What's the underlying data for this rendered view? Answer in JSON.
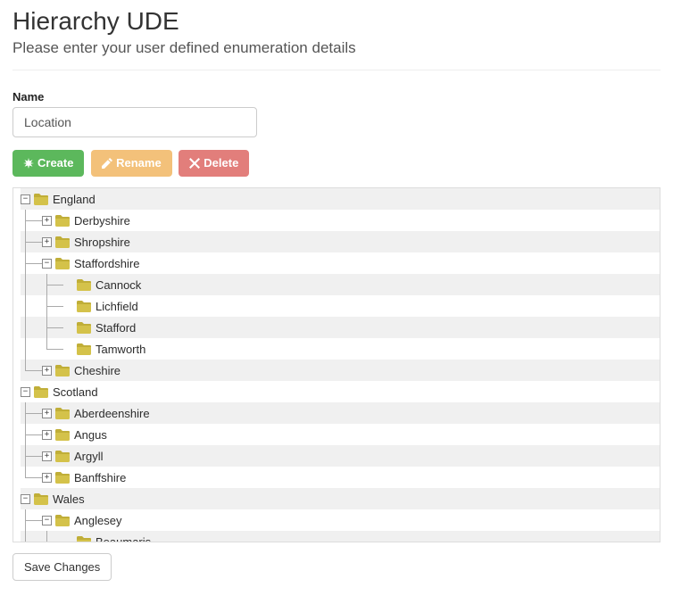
{
  "page": {
    "title": "Hierarchy UDE",
    "subtitle": "Please enter your user defined enumeration details"
  },
  "form": {
    "name_label": "Name",
    "name_value": "Location"
  },
  "buttons": {
    "create": "Create",
    "rename": "Rename",
    "delete": "Delete",
    "save": "Save Changes"
  },
  "tree_rows": [
    {
      "depth": 0,
      "toggle": "minus",
      "label": "England",
      "alt": true
    },
    {
      "depth": 1,
      "toggle": "plus",
      "label": "Derbyshire",
      "alt": false,
      "ancestors": [
        "full"
      ],
      "elbow": "tee"
    },
    {
      "depth": 1,
      "toggle": "plus",
      "label": "Shropshire",
      "alt": true,
      "ancestors": [
        "full"
      ],
      "elbow": "tee"
    },
    {
      "depth": 1,
      "toggle": "minus",
      "label": "Staffordshire",
      "alt": false,
      "ancestors": [
        "full"
      ],
      "elbow": "tee"
    },
    {
      "depth": 2,
      "toggle": "none",
      "label": "Cannock",
      "alt": true,
      "ancestors": [
        "full",
        "full"
      ],
      "elbow": "tee"
    },
    {
      "depth": 2,
      "toggle": "none",
      "label": "Lichfield",
      "alt": false,
      "ancestors": [
        "full",
        "full"
      ],
      "elbow": "tee"
    },
    {
      "depth": 2,
      "toggle": "none",
      "label": "Stafford",
      "alt": true,
      "ancestors": [
        "full",
        "full"
      ],
      "elbow": "tee"
    },
    {
      "depth": 2,
      "toggle": "none",
      "label": "Tamworth",
      "alt": false,
      "ancestors": [
        "full",
        "full"
      ],
      "elbow": "end"
    },
    {
      "depth": 1,
      "toggle": "plus",
      "label": "Cheshire",
      "alt": true,
      "ancestors": [
        "full"
      ],
      "elbow": "end"
    },
    {
      "depth": 0,
      "toggle": "minus",
      "label": "Scotland",
      "alt": false
    },
    {
      "depth": 1,
      "toggle": "plus",
      "label": "Aberdeenshire",
      "alt": true,
      "ancestors": [
        "full"
      ],
      "elbow": "tee"
    },
    {
      "depth": 1,
      "toggle": "plus",
      "label": "Angus",
      "alt": false,
      "ancestors": [
        "full"
      ],
      "elbow": "tee"
    },
    {
      "depth": 1,
      "toggle": "plus",
      "label": "Argyll",
      "alt": true,
      "ancestors": [
        "full"
      ],
      "elbow": "tee"
    },
    {
      "depth": 1,
      "toggle": "plus",
      "label": "Banffshire",
      "alt": false,
      "ancestors": [
        "full"
      ],
      "elbow": "end"
    },
    {
      "depth": 0,
      "toggle": "minus",
      "label": "Wales",
      "alt": true
    },
    {
      "depth": 1,
      "toggle": "minus",
      "label": "Anglesey",
      "alt": false,
      "ancestors": [
        "full"
      ],
      "elbow": "tee"
    },
    {
      "depth": 2,
      "toggle": "none",
      "label": "Beaumaris",
      "alt": true,
      "ancestors": [
        "full",
        "full"
      ],
      "elbow": "tee"
    }
  ],
  "colors": {
    "folder_fill": "#d4c24a",
    "folder_dark": "#c0ae38"
  }
}
